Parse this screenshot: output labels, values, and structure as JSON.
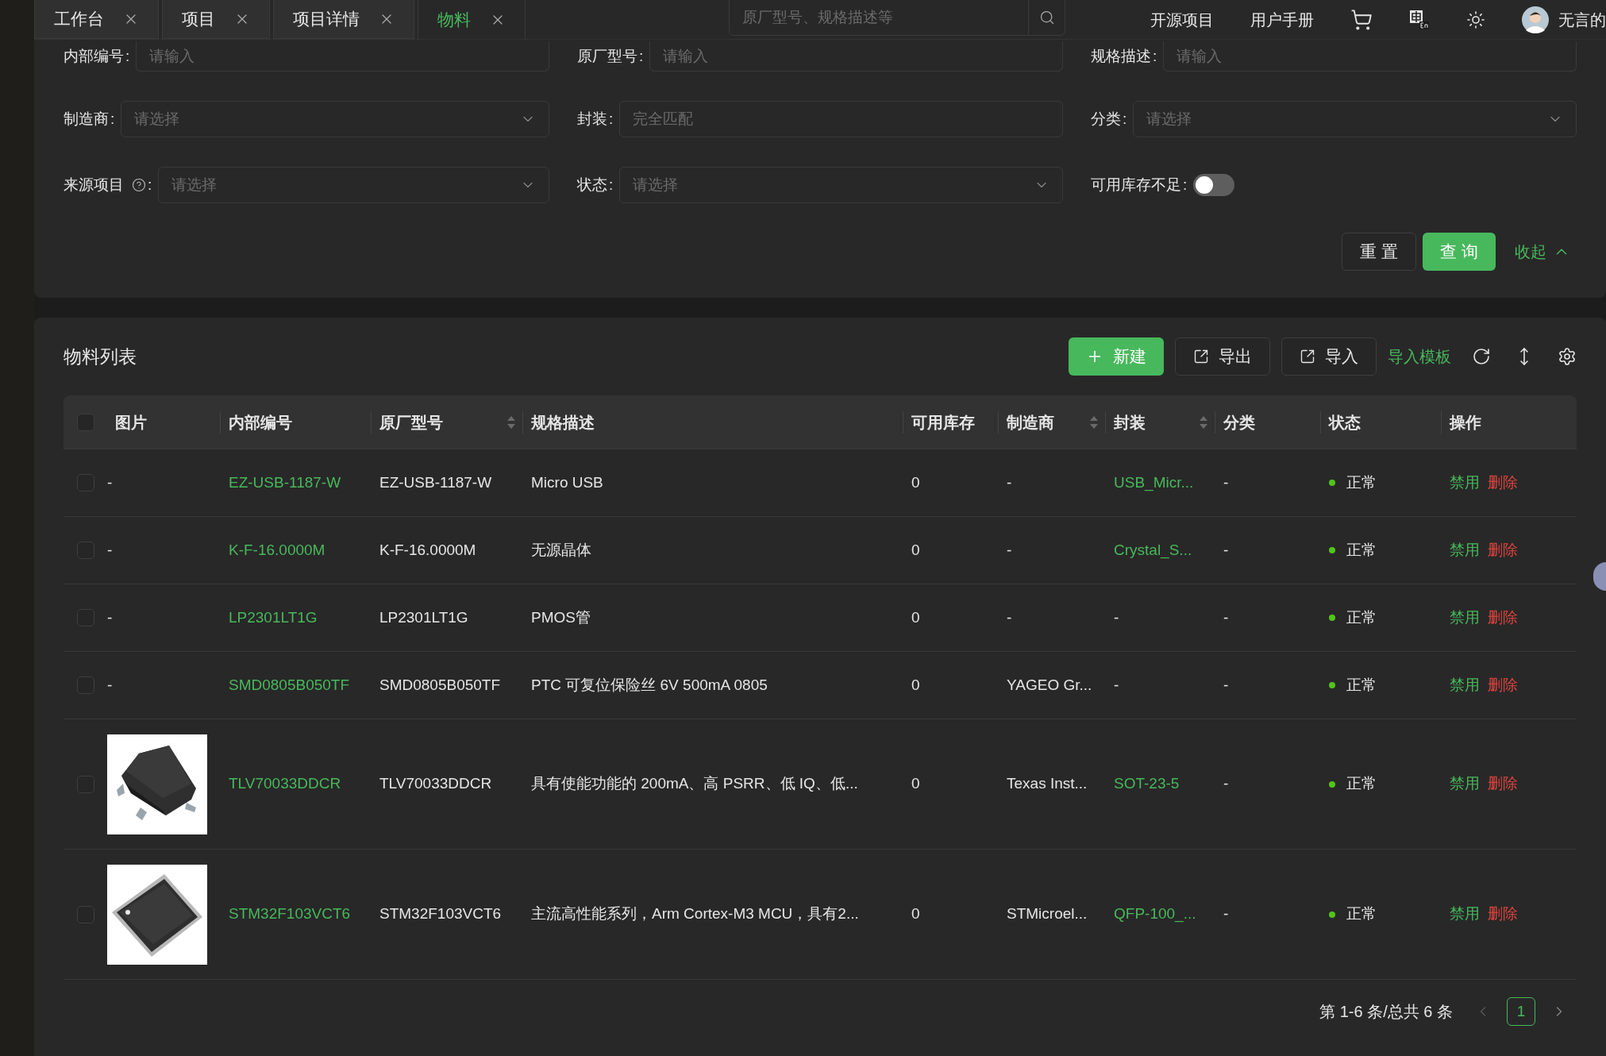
{
  "tabs": [
    {
      "label": "工作台",
      "selected": false
    },
    {
      "label": "项目",
      "selected": false
    },
    {
      "label": "项目详情",
      "selected": false
    },
    {
      "label": "物料",
      "selected": true
    }
  ],
  "global_search": {
    "placeholder": "原厂型号、规格描述等"
  },
  "header_links": [
    "开源项目",
    "用户手册"
  ],
  "user": {
    "name": "无言的"
  },
  "filters": [
    {
      "kind": "input",
      "label": "内部编号",
      "colon": ":",
      "placeholder": "请输入",
      "help": false
    },
    {
      "kind": "input",
      "label": "原厂型号",
      "colon": ":",
      "placeholder": "请输入",
      "help": false
    },
    {
      "kind": "input",
      "label": "规格描述",
      "colon": ":",
      "placeholder": "请输入",
      "help": false
    },
    {
      "kind": "select",
      "label": "制造商",
      "colon": ":",
      "placeholder": "请选择",
      "help": false
    },
    {
      "kind": "input",
      "label": "封装",
      "colon": ":",
      "placeholder": "完全匹配",
      "help": false
    },
    {
      "kind": "select",
      "label": "分类",
      "colon": ":",
      "placeholder": "请选择",
      "help": false
    },
    {
      "kind": "select",
      "label": "来源项目",
      "colon": ":",
      "placeholder": "请选择",
      "help": true
    },
    {
      "kind": "select",
      "label": "状态",
      "colon": ":",
      "placeholder": "请选择",
      "help": false
    },
    {
      "kind": "switch",
      "label": "可用库存不足",
      "colon": ":",
      "on": false,
      "help": false
    }
  ],
  "filter_actions": [
    {
      "kind": "default",
      "label": "重 置"
    },
    {
      "kind": "primary",
      "label": "查 询"
    },
    {
      "kind": "link",
      "label": "收起"
    }
  ],
  "list": {
    "title": "物料列表",
    "toolbar": [
      {
        "kind": "primary",
        "label": "新建"
      },
      {
        "kind": "default",
        "label": "导出"
      },
      {
        "kind": "default",
        "label": "导入"
      },
      {
        "kind": "link",
        "label": "导入模板"
      }
    ]
  },
  "table": {
    "select_all_checked": false,
    "columns": [
      {
        "label": "图片",
        "sortable": false
      },
      {
        "label": "内部编号",
        "sortable": false
      },
      {
        "label": "原厂型号",
        "sortable": true
      },
      {
        "label": "规格描述",
        "sortable": false
      },
      {
        "label": "可用库存",
        "sortable": false
      },
      {
        "label": "制造商",
        "sortable": true
      },
      {
        "label": "封装",
        "sortable": true
      },
      {
        "label": "分类",
        "sortable": false
      },
      {
        "label": "状态",
        "sortable": false
      },
      {
        "label": "操作",
        "sortable": false
      }
    ],
    "rows": [
      {
        "checked": false,
        "image": {
          "kind": "text",
          "text": "-"
        },
        "internal_no": "EZ-USB-1187-W",
        "mfr_part": "EZ-USB-1187-W",
        "description": "Micro USB",
        "stock": "0",
        "manufacturer": "-",
        "package": {
          "text": "USB_Micr...",
          "link": true
        },
        "category": "-",
        "status": {
          "text": "正常",
          "color": "#52c41a"
        },
        "actions": [
          {
            "kind": "link",
            "label": "禁用"
          },
          {
            "kind": "danger",
            "label": "删除"
          }
        ]
      },
      {
        "checked": false,
        "image": {
          "kind": "text",
          "text": "-"
        },
        "internal_no": "K-F-16.0000M",
        "mfr_part": "K-F-16.0000M",
        "description": "无源晶体",
        "stock": "0",
        "manufacturer": "-",
        "package": {
          "text": "Crystal_S...",
          "link": true
        },
        "category": "-",
        "status": {
          "text": "正常",
          "color": "#52c41a"
        },
        "actions": [
          {
            "kind": "link",
            "label": "禁用"
          },
          {
            "kind": "danger",
            "label": "删除"
          }
        ]
      },
      {
        "checked": false,
        "image": {
          "kind": "text",
          "text": "-"
        },
        "internal_no": "LP2301LT1G",
        "mfr_part": "LP2301LT1G",
        "description": "PMOS管",
        "stock": "0",
        "manufacturer": "-",
        "package": {
          "text": "-",
          "link": false
        },
        "category": "-",
        "status": {
          "text": "正常",
          "color": "#52c41a"
        },
        "actions": [
          {
            "kind": "link",
            "label": "禁用"
          },
          {
            "kind": "danger",
            "label": "删除"
          }
        ]
      },
      {
        "checked": false,
        "image": {
          "kind": "text",
          "text": "-"
        },
        "internal_no": "SMD0805B050TF",
        "mfr_part": "SMD0805B050TF",
        "description": "PTC 可复位保险丝 6V 500mA 0805",
        "stock": "0",
        "manufacturer": "YAGEO Gr...",
        "package": {
          "text": "-",
          "link": false
        },
        "category": "-",
        "status": {
          "text": "正常",
          "color": "#52c41a"
        },
        "actions": [
          {
            "kind": "link",
            "label": "禁用"
          },
          {
            "kind": "danger",
            "label": "删除"
          }
        ]
      },
      {
        "checked": false,
        "image": {
          "kind": "picture"
        },
        "internal_no": "TLV70033DDCR",
        "mfr_part": "TLV70033DDCR",
        "description": "具有使能功能的 200mA、高 PSRR、低 IQ、低...",
        "stock": "0",
        "manufacturer": "Texas Inst...",
        "package": {
          "text": "SOT-23-5",
          "link": true
        },
        "category": "-",
        "status": {
          "text": "正常",
          "color": "#52c41a"
        },
        "actions": [
          {
            "kind": "link",
            "label": "禁用"
          },
          {
            "kind": "danger",
            "label": "删除"
          }
        ]
      },
      {
        "checked": false,
        "image": {
          "kind": "picture"
        },
        "internal_no": "STM32F103VCT6",
        "mfr_part": "STM32F103VCT6",
        "description": "主流高性能系列，Arm Cortex-M3 MCU，具有2...",
        "stock": "0",
        "manufacturer": "STMicroel...",
        "package": {
          "text": "QFP-100_...",
          "link": true
        },
        "category": "-",
        "status": {
          "text": "正常",
          "color": "#52c41a"
        },
        "actions": [
          {
            "kind": "link",
            "label": "禁用"
          },
          {
            "kind": "danger",
            "label": "删除"
          }
        ]
      }
    ],
    "pagination": {
      "summary": "第 1-6 条/总共 6 条",
      "pages": [
        {
          "label": "1",
          "selected": true
        }
      ]
    }
  }
}
